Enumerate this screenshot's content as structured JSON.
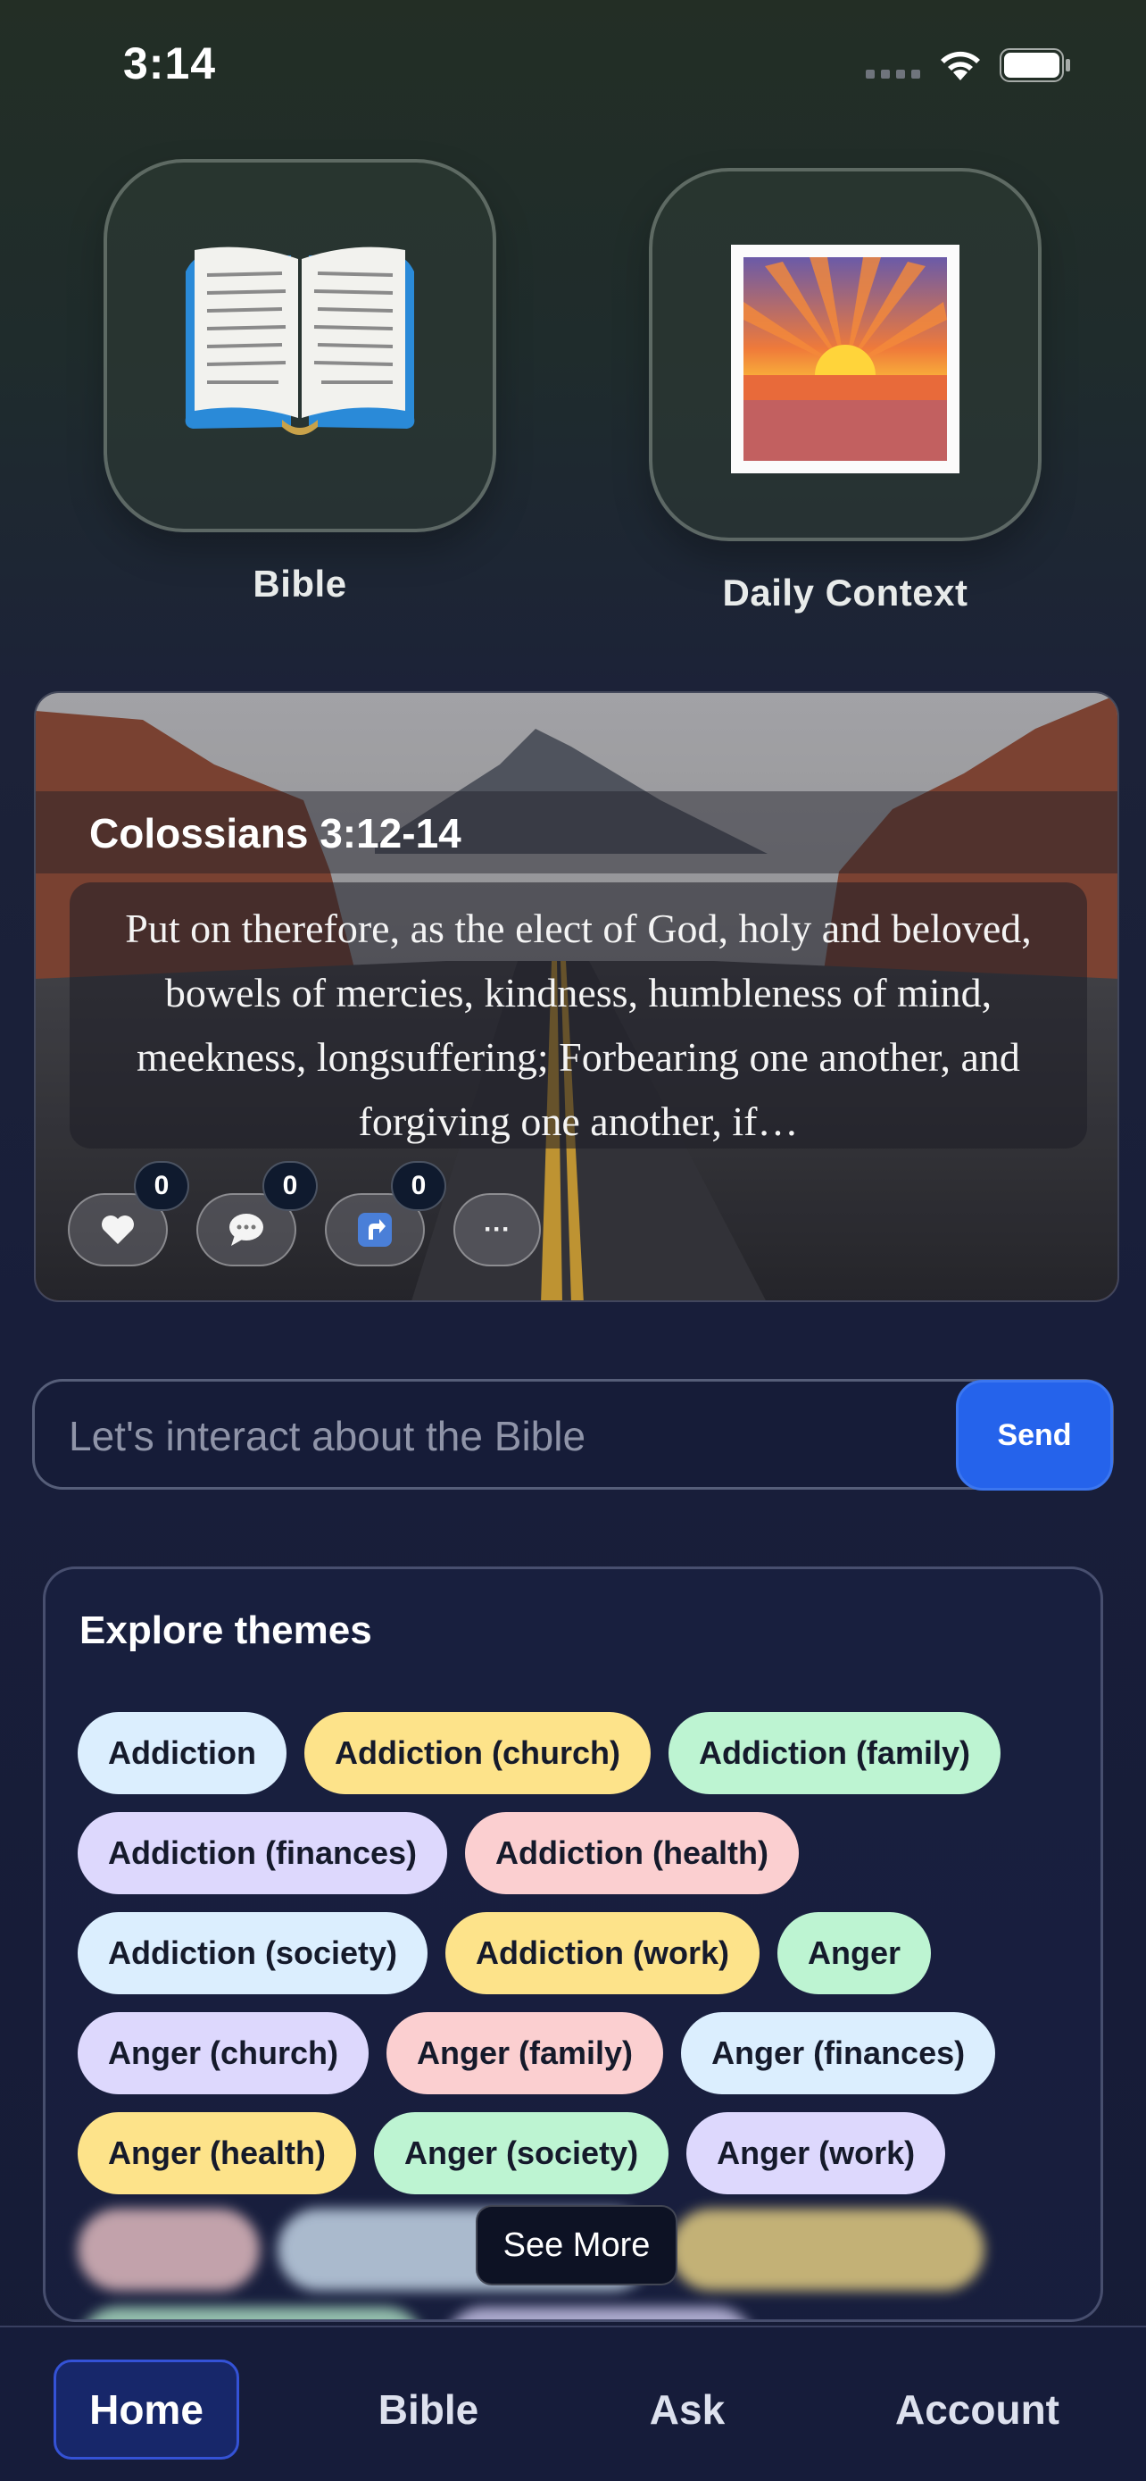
{
  "status": {
    "time": "3:14"
  },
  "tiles": {
    "bible_label": "Bible",
    "daily_label": "Daily Context"
  },
  "verse": {
    "reference": "Colossians 3:12-14",
    "text": "Put on therefore, as the elect of God, holy and beloved, bowels of mercies, kindness, humbleness of mind, meekness, longsuffering; Forbearing one another, and forgiving one another, if…",
    "likes": "0",
    "comments": "0",
    "shares": "0",
    "more_label": "···"
  },
  "chat": {
    "placeholder": "Let's interact about the Bible",
    "send_label": "Send"
  },
  "themes": {
    "title": "Explore themes",
    "chips": [
      "Addiction",
      "Addiction (church)",
      "Addiction (family)",
      "Addiction (finances)",
      "Addiction (health)",
      "Addiction (society)",
      "Addiction (work)",
      "Anger",
      "Anger (church)",
      "Anger (family)",
      "Anger (finances)",
      "Anger (health)",
      "Anger (society)",
      "Anger (work)"
    ],
    "see_more_label": "See More"
  },
  "nav": {
    "home": "Home",
    "bible": "Bible",
    "ask": "Ask",
    "account": "Account",
    "active": "Home"
  },
  "colors": {
    "accent": "#2563eb",
    "chip_blue": "#dbeefe",
    "chip_yellow": "#fde38a",
    "chip_green": "#bdf4d2",
    "chip_purple": "#ddd8fd",
    "chip_pink": "#fbcfd0"
  }
}
